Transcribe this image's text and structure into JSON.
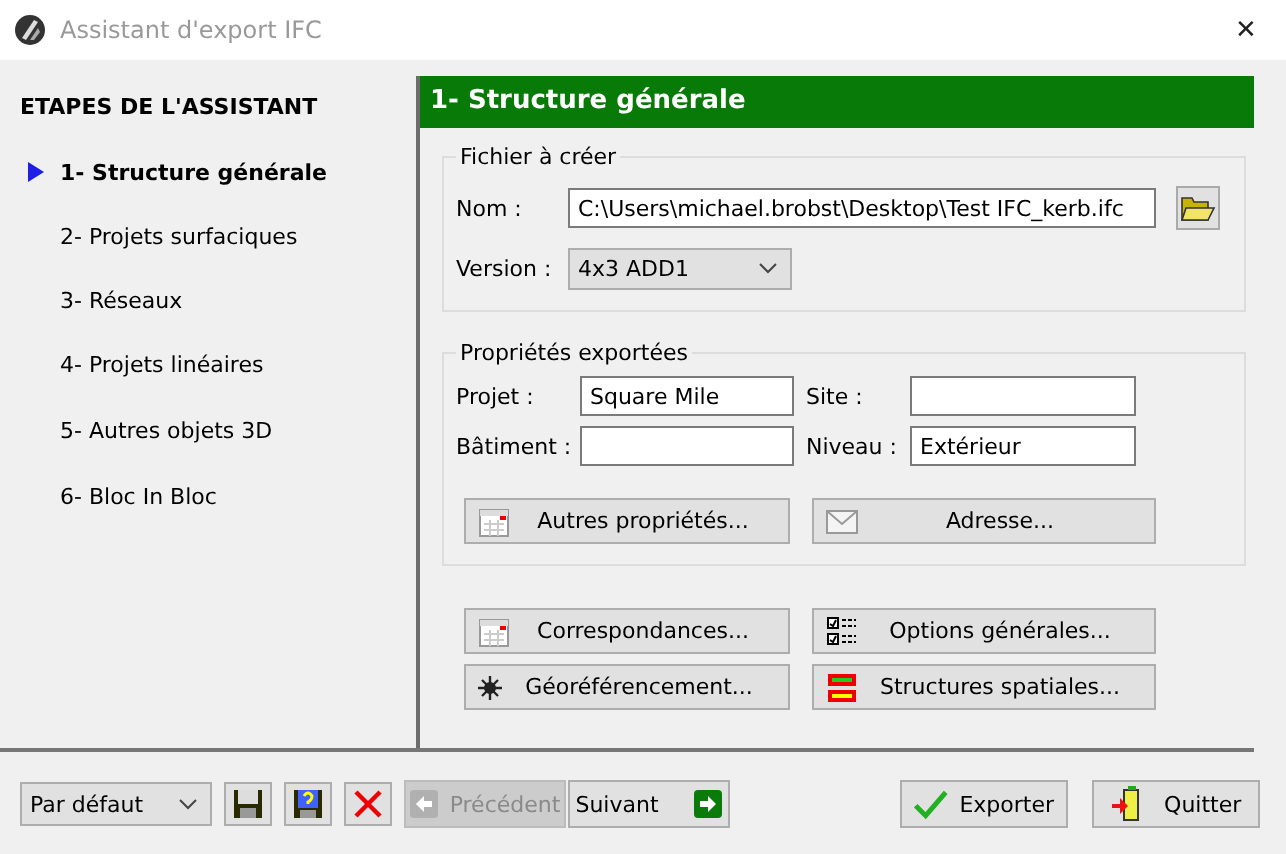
{
  "window": {
    "title": "Assistant d'export IFC",
    "close": "✕"
  },
  "sidebar": {
    "heading": "ETAPES DE L'ASSISTANT",
    "items": [
      {
        "label": "1- Structure générale",
        "selected": true
      },
      {
        "label": "2- Projets surfaciques",
        "selected": false
      },
      {
        "label": "3- Réseaux",
        "selected": false
      },
      {
        "label": "4- Projets linéaires",
        "selected": false
      },
      {
        "label": "5- Autres objets 3D",
        "selected": false
      },
      {
        "label": "6- Bloc In Bloc",
        "selected": false
      }
    ]
  },
  "panel": {
    "title": "1- Structure générale",
    "file_group": {
      "legend": "Fichier à créer",
      "name_label": "Nom :",
      "name_value": "C:\\Users\\michael.brobst\\Desktop\\Test IFC_kerb.ifc",
      "version_label": "Version :",
      "version_value": "4x3 ADD1"
    },
    "props_group": {
      "legend": "Propriétés exportées",
      "fields": [
        {
          "label": "Projet :",
          "value": "Square Mile"
        },
        {
          "label": "Site :"
        },
        {
          "label": "Bâtiment :"
        },
        {
          "label": "Niveau :",
          "value": "Extérieur"
        }
      ],
      "buttons": [
        {
          "label": "Autres propriétés...",
          "kind": "calendar"
        },
        {
          "label": "Adresse...",
          "kind": "envelope"
        }
      ]
    },
    "buttons": [
      {
        "label": "Correspondances...",
        "kind": "calendar"
      },
      {
        "label": "Options générales...",
        "kind": "checklist"
      },
      {
        "label": "Géoréférencement...",
        "kind": "gear"
      },
      {
        "label": "Structures spatiales...",
        "kind": "blocks"
      }
    ]
  },
  "bottom": {
    "preset": "Par défaut",
    "previous": {
      "label": "Précédent",
      "disabled": true
    },
    "next": {
      "label": "Suivant",
      "disabled": false
    },
    "export": "Exporter",
    "quit": "Quitter"
  }
}
